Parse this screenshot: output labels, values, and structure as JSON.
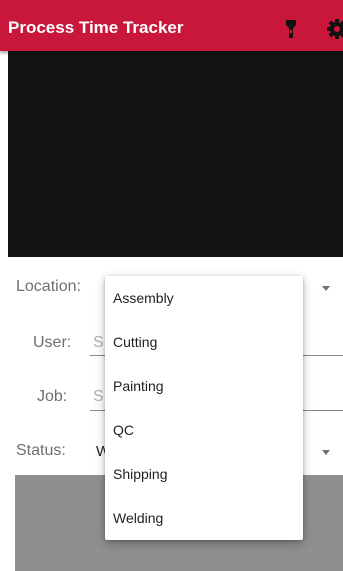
{
  "app": {
    "title": "Process Time Tracker",
    "accent_color": "#c8173a",
    "icons": [
      "flashlight-icon",
      "gear-icon"
    ]
  },
  "form": {
    "location_label": "Location:",
    "user_label": "User:",
    "user_hint": "S",
    "job_label": "Job:",
    "job_hint": "S",
    "status_label": "Status:",
    "status_value": "W"
  },
  "dropdown": {
    "options": [
      "Assembly",
      "Cutting",
      "Painting",
      "QC",
      "Shipping",
      "Welding"
    ]
  }
}
